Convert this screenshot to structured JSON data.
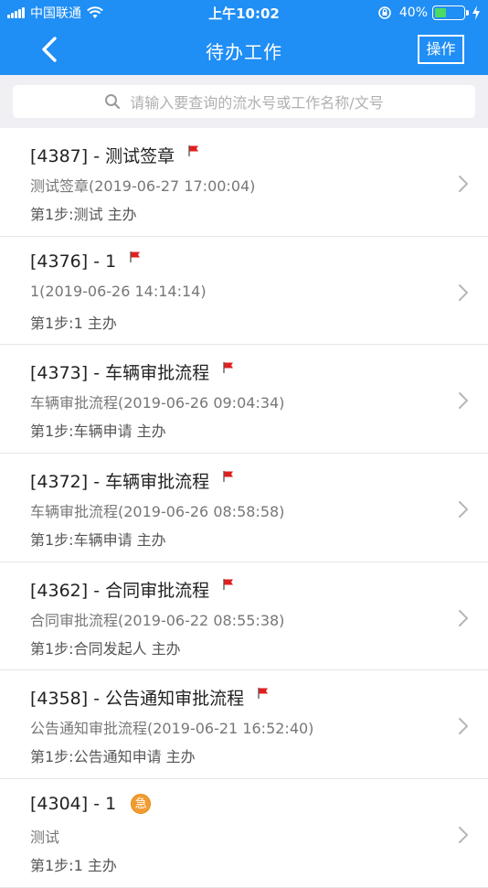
{
  "status_bar": {
    "carrier": "中国联通",
    "time": "上午10:02",
    "battery": "40%"
  },
  "navbar": {
    "title": "待办工作",
    "action_label": "操作"
  },
  "search": {
    "placeholder": "请输入要查询的流水号或工作名称/文号"
  },
  "items": [
    {
      "title": "[4387] - 测试签章",
      "sub": "测试签章(2019-06-27 17:00:04)",
      "step": "第1步:测试 主办",
      "marker": "flag"
    },
    {
      "title": "[4376] - 1",
      "sub": "1(2019-06-26 14:14:14)",
      "step": "第1步:1 主办",
      "marker": "flag"
    },
    {
      "title": "[4373] - 车辆审批流程",
      "sub": "车辆审批流程(2019-06-26 09:04:34)",
      "step": "第1步:车辆申请 主办",
      "marker": "flag"
    },
    {
      "title": "[4372] - 车辆审批流程",
      "sub": "车辆审批流程(2019-06-26 08:58:58)",
      "step": "第1步:车辆申请 主办",
      "marker": "flag"
    },
    {
      "title": "[4362] - 合同审批流程",
      "sub": "合同审批流程(2019-06-22 08:55:38)",
      "step": "第1步:合同发起人 主办",
      "marker": "flag"
    },
    {
      "title": "[4358] - 公告通知审批流程",
      "sub": "公告通知审批流程(2019-06-21 16:52:40)",
      "step": "第1步:公告通知申请 主办",
      "marker": "flag"
    },
    {
      "title": "[4304] - 1",
      "sub": "测试",
      "step": "第1步:1 主办",
      "marker": "urgent",
      "urgent_label": "急"
    }
  ],
  "colors": {
    "header": "#1f8ef5",
    "flag": "#e02020",
    "urgent": "#f29c30"
  }
}
